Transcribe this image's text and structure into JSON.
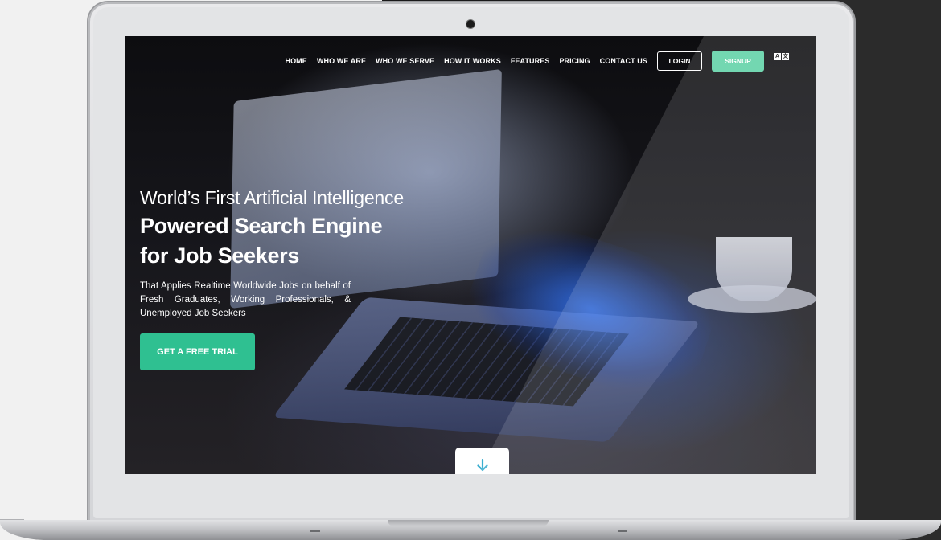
{
  "nav": {
    "links": [
      "HOME",
      "WHO WE ARE",
      "WHO WE SERVE",
      "HOW IT WORKS",
      "FEATURES",
      "PRICING",
      "CONTACT US"
    ],
    "login_label": "LOGIN",
    "signup_label": "SIGNUP",
    "lang_icon": "translate-icon"
  },
  "hero": {
    "line1": "World’s First Artificial Intelligence",
    "line2": "Powered Search Engine",
    "line3": "for Job Seekers",
    "subtitle": "That Applies Realtime Worldwide Jobs on behalf of Fresh Graduates, Working Professionals, & Unemployed Job Seekers",
    "cta_label": "GET A FREE TRIAL"
  },
  "scroll": {
    "icon": "arrow-down-icon"
  },
  "colors": {
    "signup": "#5fd2a6",
    "cta": "#2fc091",
    "scroll_arrow": "#3aaed0"
  }
}
